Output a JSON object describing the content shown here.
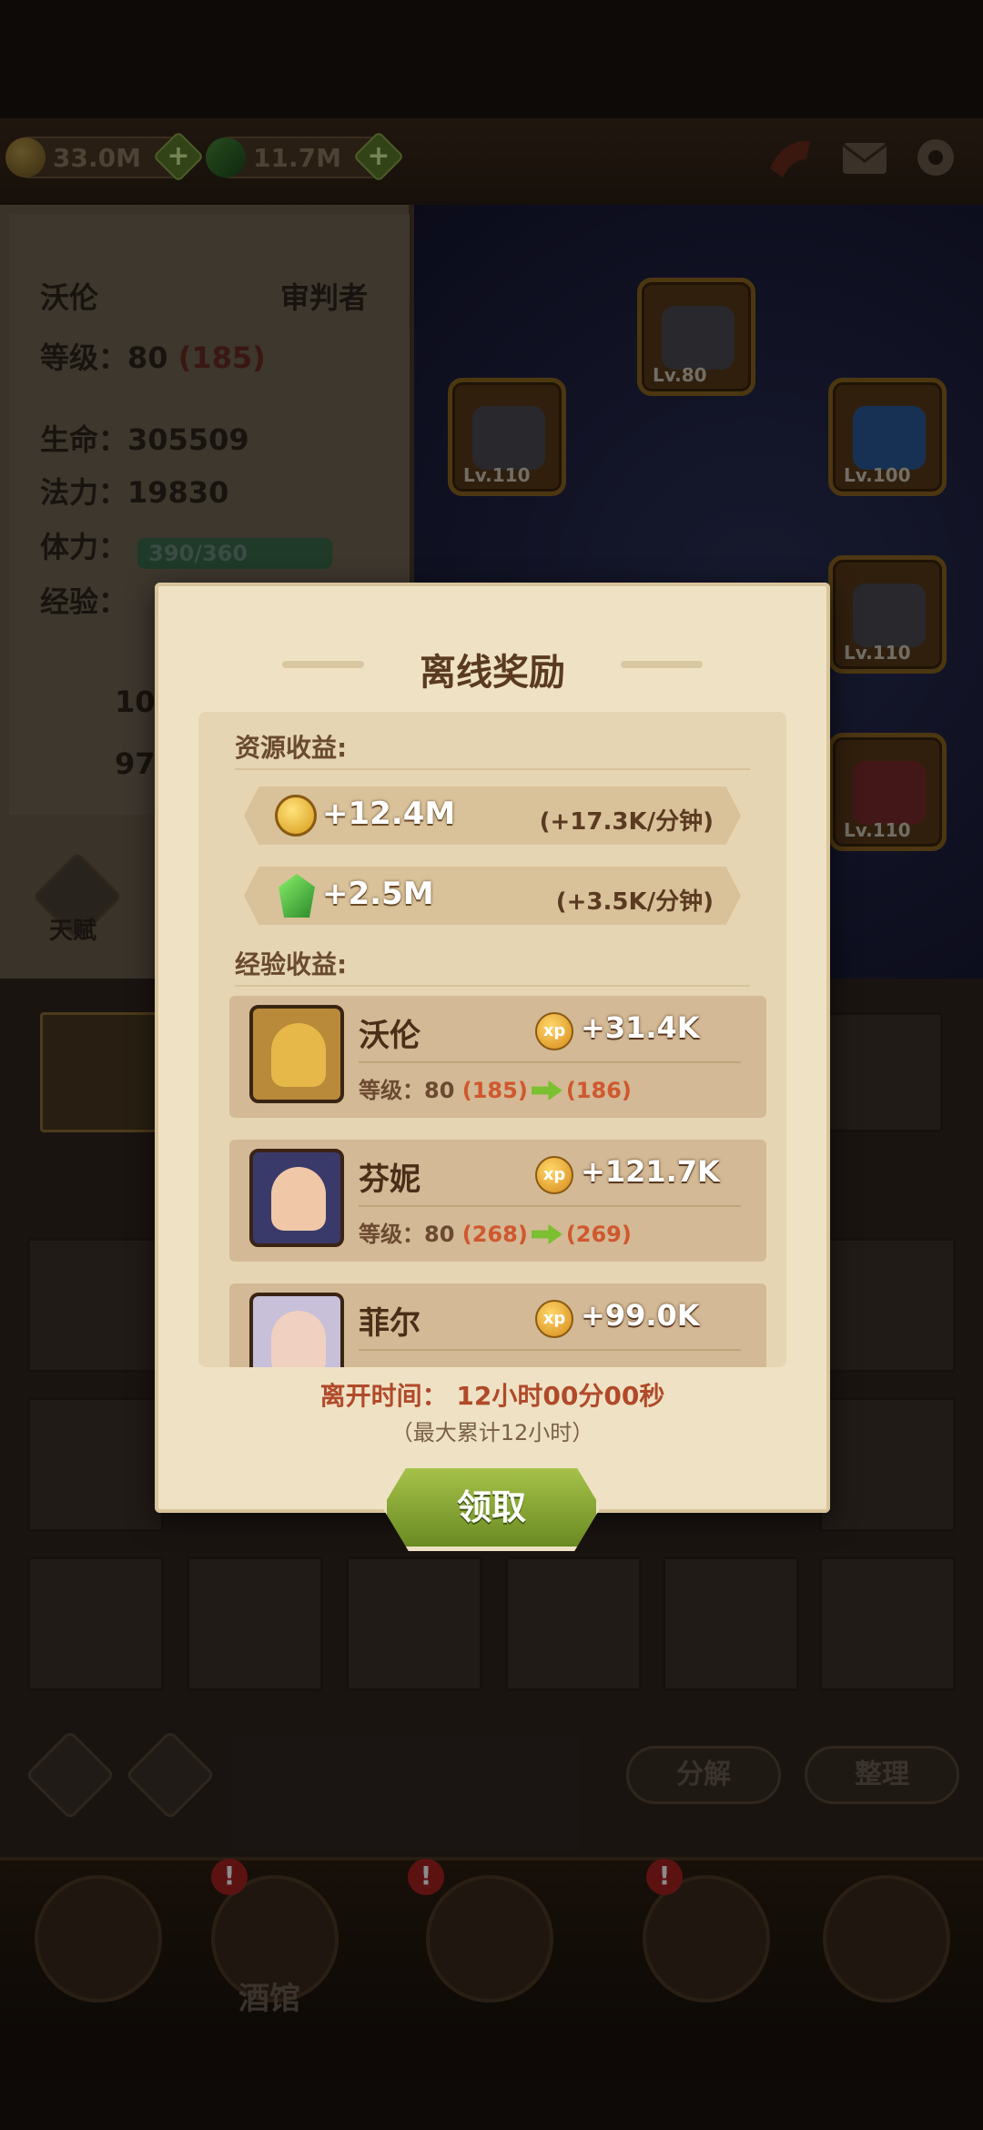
{
  "resources": {
    "gold": "33.0M",
    "gems": "11.7M"
  },
  "hero_panel": {
    "name": "沃伦",
    "class": "审判者",
    "level_label": "等级：",
    "level": "80",
    "level_bonus": "(185)",
    "hp_label": "生命：",
    "hp": "305509",
    "mp_label": "法力：",
    "mp": "19830",
    "stamina_label": "体力：",
    "stamina": "390/360",
    "xp_label": "经验：",
    "atk_partial": "10",
    "def_partial": "97",
    "talent_label": "天赋"
  },
  "equipment": [
    {
      "level": "Lv.80"
    },
    {
      "level": "Lv.110"
    },
    {
      "level": "Lv.100"
    },
    {
      "level": "Lv.110"
    },
    {
      "level": "Lv.110"
    }
  ],
  "bottom_buttons": {
    "decompose": "分解",
    "sort": "整理"
  },
  "nav": {
    "tavern_label": "酒馆"
  },
  "modal": {
    "title": "离线奖励",
    "resource_section": "资源收益:",
    "gold_amount": "+12.4M",
    "gold_rate": "(+17.3K/分钟)",
    "gem_amount": "+2.5M",
    "gem_rate": "(+3.5K/分钟)",
    "exp_section": "经验收益:",
    "heroes": [
      {
        "name": "沃伦",
        "xp": "+31.4K",
        "level_label": "等级：",
        "level": "80",
        "from": "(185)",
        "to": "(186)"
      },
      {
        "name": "芬妮",
        "xp": "+121.7K",
        "level_label": "等级：",
        "level": "80",
        "from": "(268)",
        "to": "(269)"
      },
      {
        "name": "菲尔",
        "xp": "+99.0K"
      }
    ],
    "away_time": "离开时间：  12小时00分00秒",
    "max_note": "（最大累计12小时）",
    "claim_label": "领取"
  },
  "colors": {
    "accent_green": "#7ac030",
    "bonus_red": "#d0582e",
    "title_brown": "#5a3a20"
  }
}
